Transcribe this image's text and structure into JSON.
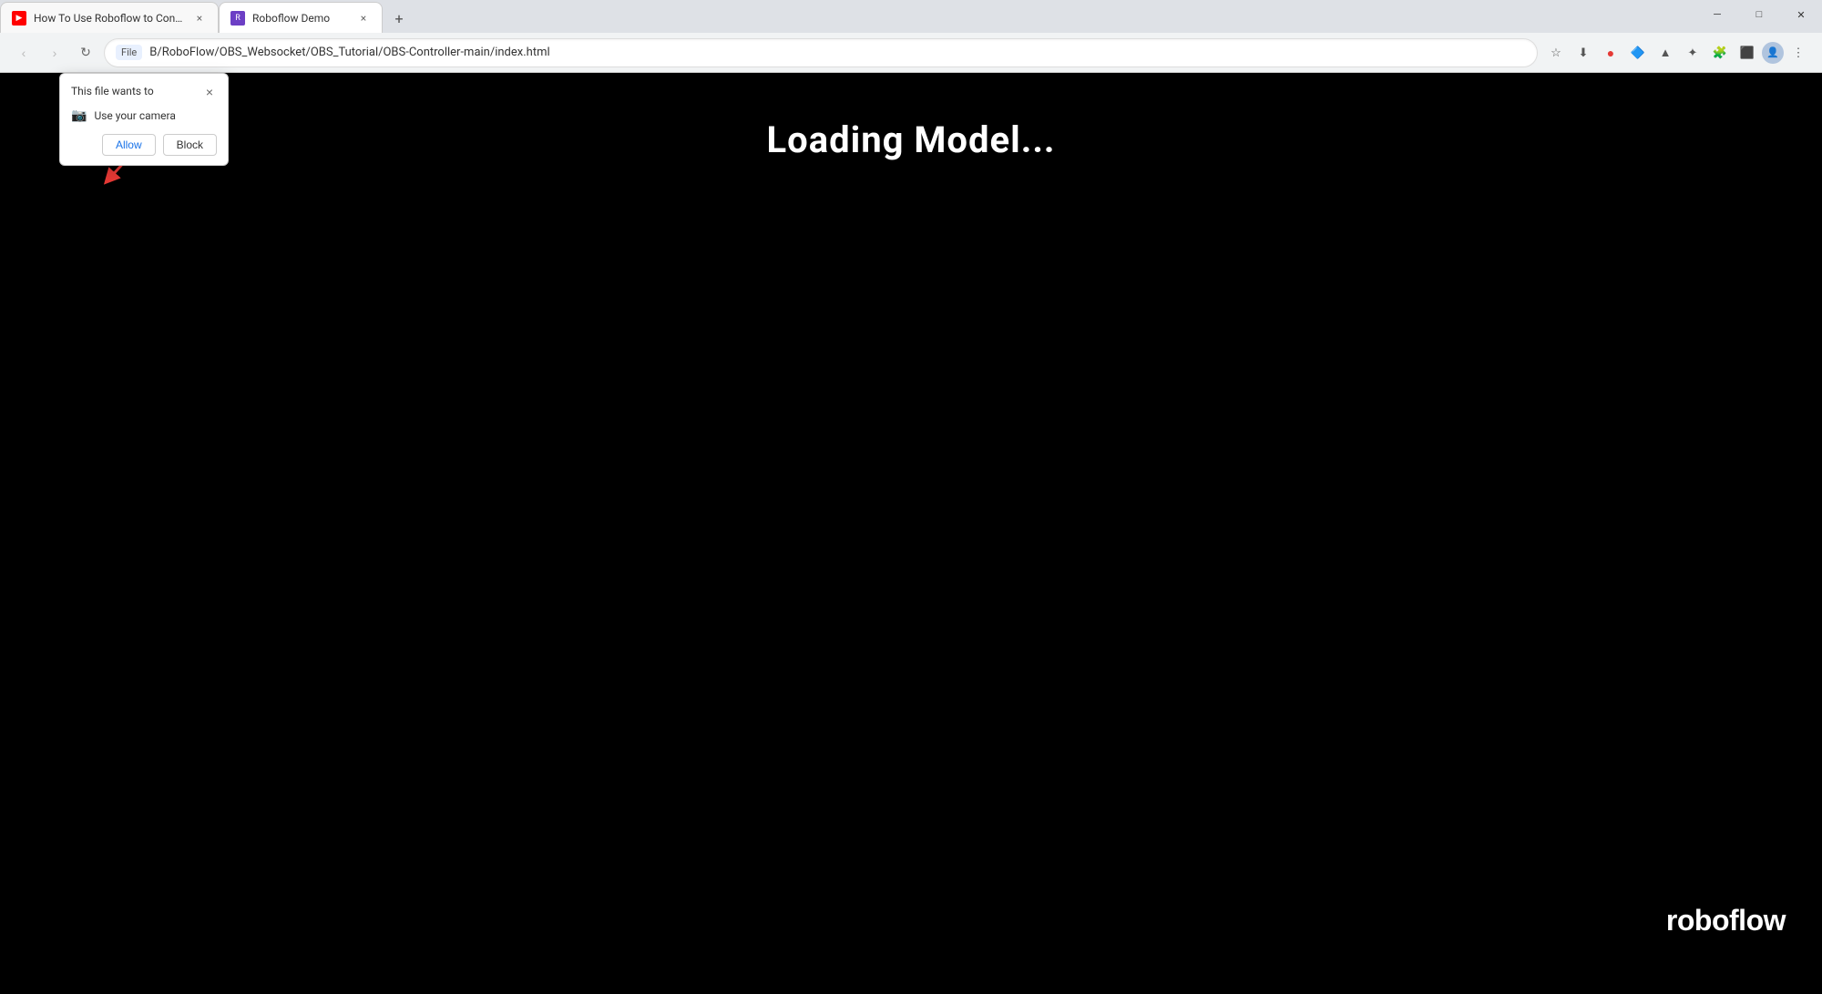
{
  "browser": {
    "tabs": [
      {
        "id": "tab1",
        "title": "How To Use Roboflow to Contr...",
        "active": false,
        "favicon": "yt"
      },
      {
        "id": "tab2",
        "title": "Roboflow Demo",
        "active": true,
        "favicon": "rf"
      }
    ],
    "new_tab_label": "+",
    "url": "B/RoboFlow/OBS_Websocket/OBS_Tutorial/OBS-Controller-main/index.html",
    "site_info_label": "File",
    "nav": {
      "back": "‹",
      "forward": "›",
      "refresh": "↻",
      "home": ""
    }
  },
  "permission_popup": {
    "title": "This file wants to",
    "close_label": "×",
    "permission_item": "Use your camera",
    "allow_label": "Allow",
    "block_label": "Block"
  },
  "page": {
    "loading_text": "Loading Model...",
    "brand": "roboflow"
  },
  "toolbar_icons": {
    "download": "⬇",
    "bookmark": "☆",
    "extensions_alert": "🔴",
    "profiles": "👤",
    "puzzle": "🧩",
    "settings": "⋮"
  }
}
